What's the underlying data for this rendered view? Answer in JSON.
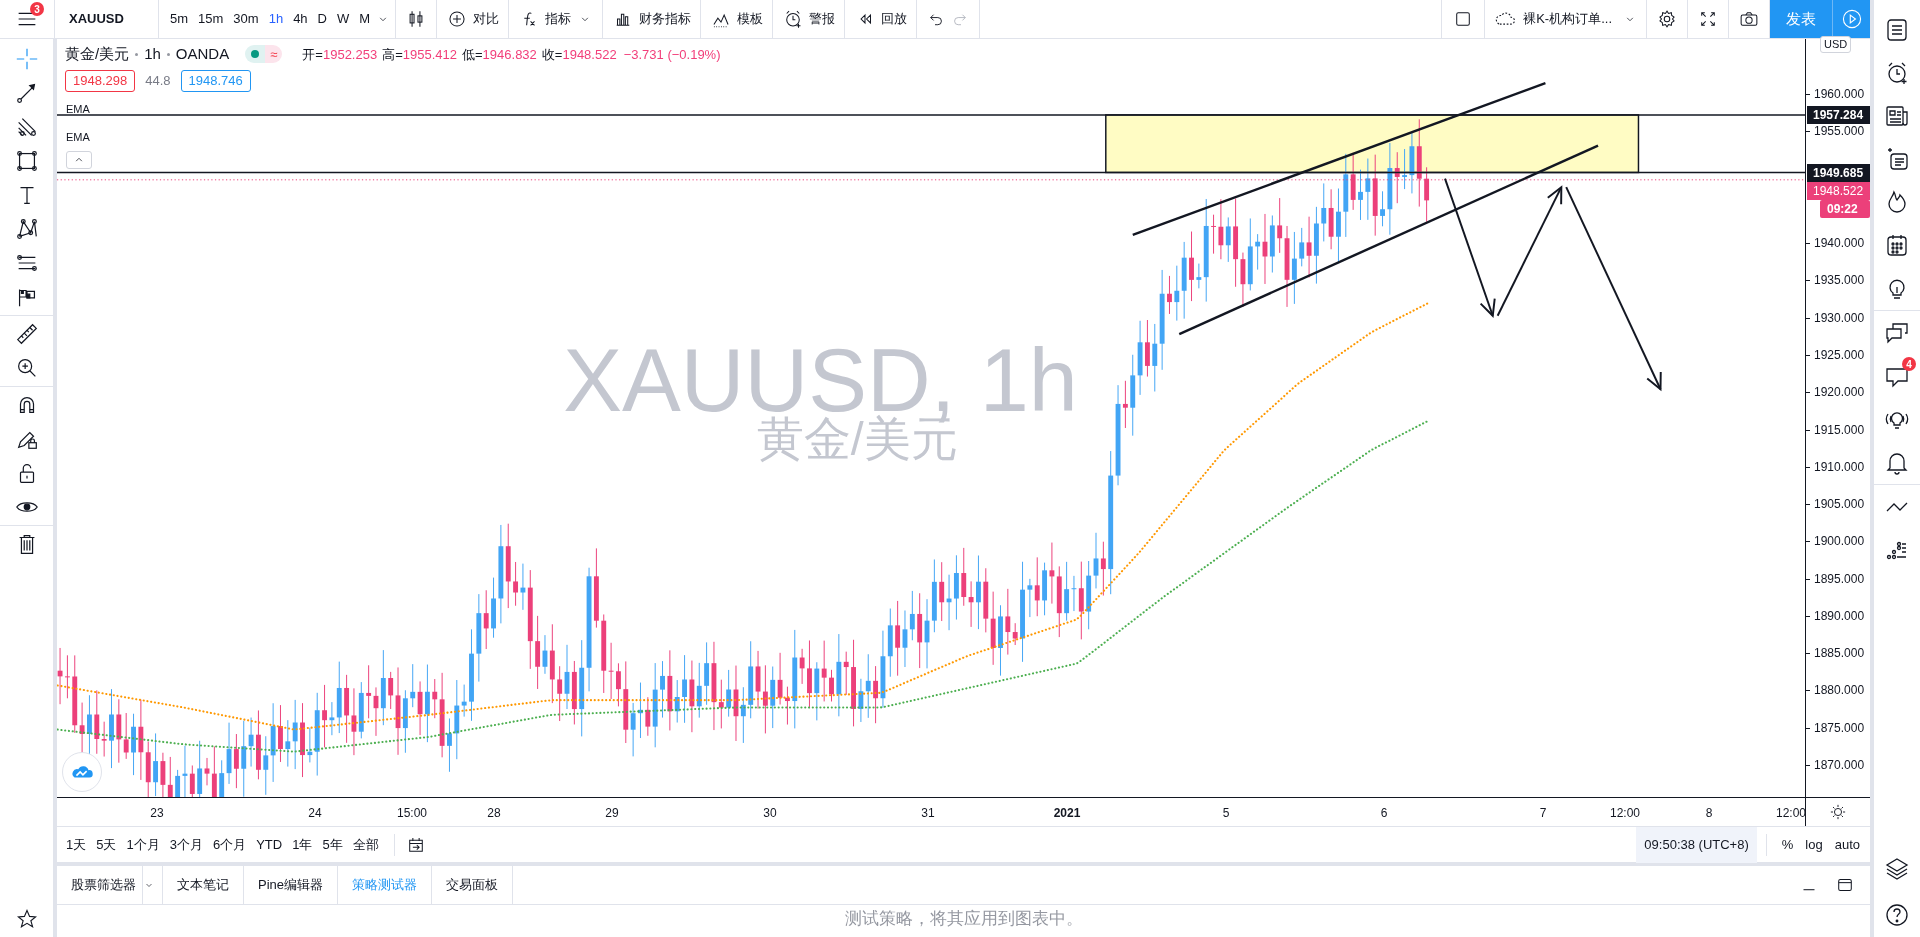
{
  "top_bar": {
    "notifications": "3",
    "symbol": "XAUUSD",
    "intervals": [
      {
        "label": "5m",
        "selected": false
      },
      {
        "label": "15m",
        "selected": false
      },
      {
        "label": "30m",
        "selected": false
      },
      {
        "label": "1h",
        "selected": true
      },
      {
        "label": "4h",
        "selected": false
      },
      {
        "label": "D",
        "selected": false
      },
      {
        "label": "W",
        "selected": false
      },
      {
        "label": "M",
        "selected": false
      }
    ],
    "tools": [
      {
        "label": "对比"
      },
      {
        "label": "指标"
      },
      {
        "label": "财务指标"
      },
      {
        "label": "模板"
      },
      {
        "label": "警报"
      },
      {
        "label": "回放"
      }
    ],
    "layout_name": "裸K-机构订单...",
    "publish_button": "发表"
  },
  "legend": {
    "title": "黄金/美元",
    "interval": "1h",
    "source": "OANDA",
    "status": "≈",
    "ohlc": [
      {
        "label": "开=",
        "value": "1952.253"
      },
      {
        "label": "高=",
        "value": "1955.412"
      },
      {
        "label": "低=",
        "value": "1946.832"
      },
      {
        "label": "收=",
        "value": "1948.522"
      }
    ],
    "change": "−3.731 (−0.19%)",
    "bid": "1948.298",
    "spread": "44.8",
    "ask": "1948.746",
    "indicators": [
      "EMA",
      "EMA"
    ]
  },
  "watermark": {
    "symbol": "XAUUSD, 1h",
    "name": "黄金/美元"
  },
  "price_axis": {
    "currency": "USD",
    "labels": [
      "1960.000",
      "1955.000",
      "1940.000",
      "1935.000",
      "1930.000",
      "1925.000",
      "1920.000",
      "1915.000",
      "1910.000",
      "1905.000",
      "1900.000",
      "1895.000",
      "1890.000",
      "1885.000",
      "1880.000",
      "1875.000",
      "1870.000"
    ],
    "markers": [
      {
        "kind": "line",
        "text": "1957.284"
      },
      {
        "kind": "line",
        "text": "1949.685"
      },
      {
        "kind": "price",
        "text": "1948.522"
      },
      {
        "kind": "countdown",
        "text": "09:22"
      }
    ]
  },
  "time_axis": [
    "23",
    "24",
    "15:00",
    "28",
    "29",
    "30",
    "31",
    "2021",
    "5",
    "6",
    "7",
    "12:00",
    "8",
    "12:00"
  ],
  "ranges": [
    "1天",
    "5天",
    "1个月",
    "3个月",
    "6个月",
    "YTD",
    "1年",
    "5年",
    "全部"
  ],
  "clock": "09:50:38 (UTC+8)",
  "scale_options": [
    "%",
    "log",
    "auto"
  ],
  "bottom_panel": {
    "tabs": [
      {
        "label": "股票筛选器",
        "selected": false
      },
      {
        "label": "文本笔记",
        "selected": false
      },
      {
        "label": "Pine编辑器",
        "selected": false
      },
      {
        "label": "策略测试器",
        "selected": true
      },
      {
        "label": "交易面板",
        "selected": false
      }
    ],
    "message": "测试策略，将其应用到图表中。"
  },
  "right_sidebar": {
    "chat_badge": "4"
  }
}
